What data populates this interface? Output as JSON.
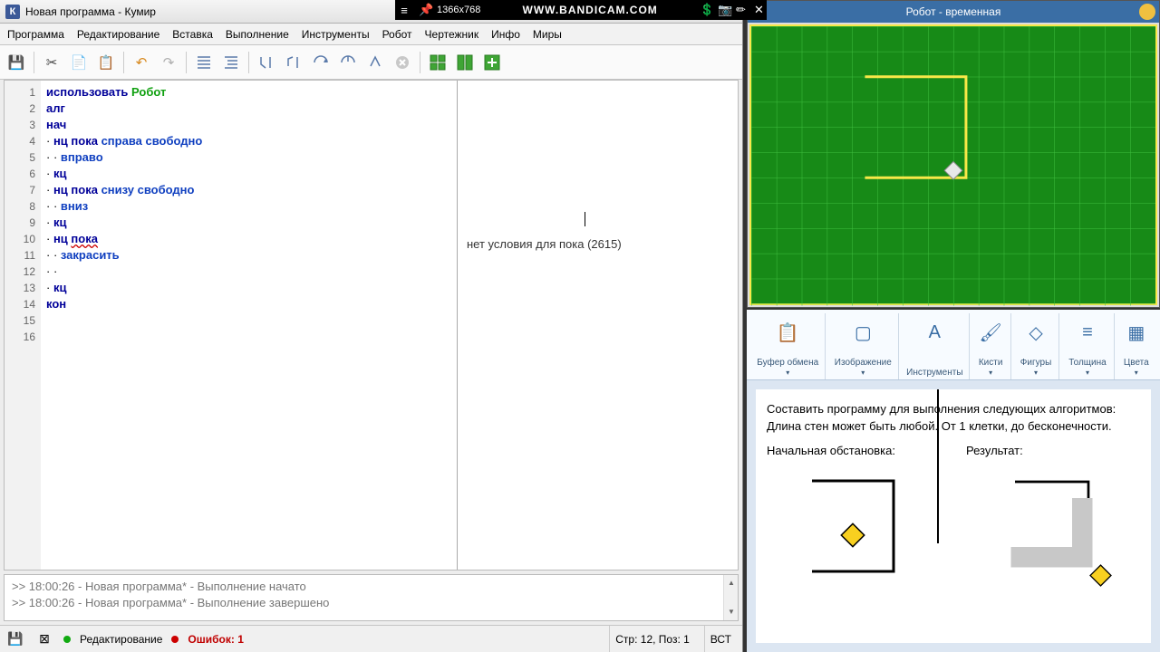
{
  "bandicam": {
    "menu_icon": "≡",
    "pin_icon": "📌",
    "resolution": "1366x768",
    "logo": "WWW.BANDICAM.COM",
    "rec_icon": "💲",
    "cam_icon": "📷",
    "pen_icon": "✏",
    "close_icon": "✕"
  },
  "kumir": {
    "title": "Новая программа - Кумир",
    "menu": [
      "Программа",
      "Редактирование",
      "Вставка",
      "Выполнение",
      "Инструменты",
      "Робот",
      "Чертежник",
      "Инфо",
      "Миры"
    ],
    "code_lines": [
      {
        "n": 1,
        "tokens": [
          {
            "t": "использовать ",
            "c": "kw-use"
          },
          {
            "t": "Робот",
            "c": "kw-robot"
          }
        ]
      },
      {
        "n": 2,
        "tokens": [
          {
            "t": "алг",
            "c": "kw"
          }
        ]
      },
      {
        "n": 3,
        "tokens": [
          {
            "t": "нач",
            "c": "kw"
          }
        ]
      },
      {
        "n": 4,
        "tokens": [
          {
            "t": "· ",
            "c": ""
          },
          {
            "t": "нц пока ",
            "c": "kw"
          },
          {
            "t": "справа свободно",
            "c": "kw-dir"
          }
        ]
      },
      {
        "n": 5,
        "tokens": [
          {
            "t": "· · ",
            "c": ""
          },
          {
            "t": "вправо",
            "c": "kw-dir"
          }
        ]
      },
      {
        "n": 6,
        "tokens": [
          {
            "t": "· ",
            "c": ""
          },
          {
            "t": "кц",
            "c": "kw"
          }
        ]
      },
      {
        "n": 7,
        "tokens": [
          {
            "t": "· ",
            "c": ""
          },
          {
            "t": "нц пока ",
            "c": "kw"
          },
          {
            "t": "снизу свободно",
            "c": "kw-dir"
          }
        ]
      },
      {
        "n": 8,
        "tokens": [
          {
            "t": "· · ",
            "c": ""
          },
          {
            "t": "вниз",
            "c": "kw-dir"
          }
        ]
      },
      {
        "n": 9,
        "tokens": [
          {
            "t": "· ",
            "c": ""
          },
          {
            "t": "кц",
            "c": "kw"
          }
        ]
      },
      {
        "n": 10,
        "tokens": [
          {
            "t": "· ",
            "c": ""
          },
          {
            "t": "нц ",
            "c": "kw"
          },
          {
            "t": "пока",
            "c": "kw-err"
          }
        ]
      },
      {
        "n": 11,
        "tokens": [
          {
            "t": "· · ",
            "c": ""
          },
          {
            "t": "закрасить",
            "c": "kw-paint"
          }
        ]
      },
      {
        "n": 12,
        "tokens": [
          {
            "t": "· ·",
            "c": ""
          }
        ]
      },
      {
        "n": 13,
        "tokens": [
          {
            "t": "· ",
            "c": ""
          },
          {
            "t": "кц",
            "c": "kw"
          }
        ]
      },
      {
        "n": 14,
        "tokens": [
          {
            "t": "кон",
            "c": "kw"
          }
        ]
      },
      {
        "n": 15,
        "tokens": []
      },
      {
        "n": 16,
        "tokens": []
      }
    ],
    "error_message": "нет условия для пока  (2615)",
    "console": [
      ">> 18:00:26 - Новая программа* - Выполнение начато",
      ">> 18:00:26 - Новая программа* - Выполнение завершено"
    ],
    "status": {
      "mode": "Редактирование",
      "error_label": "Ошибок: 1",
      "position": "Стр: 12, Поз: 1",
      "insert": "ВСТ"
    }
  },
  "robot": {
    "title": "Робот - временная"
  },
  "paint": {
    "groups": [
      {
        "icon": "📋",
        "label": "Буфер\nобмена",
        "arrow": true
      },
      {
        "icon": "▢",
        "label": "Изображение",
        "arrow": true
      },
      {
        "icon": "A",
        "label": "Инструменты",
        "arrow": false
      },
      {
        "icon": "🖌",
        "label": "Кисти",
        "arrow": true
      },
      {
        "icon": "◇",
        "label": "Фигуры",
        "arrow": true
      },
      {
        "icon": "≡",
        "label": "Толщина",
        "arrow": true
      },
      {
        "icon": "▦",
        "label": "Цвета",
        "arrow": true
      }
    ]
  },
  "task": {
    "line1": "Составить программу для выполнения следующих алгоритмов:",
    "line2": "Длина стен может быть любой. От 1 клетки, до бесконечности.",
    "initial_label": "Начальная обстановка:",
    "result_label": "Результат:"
  }
}
